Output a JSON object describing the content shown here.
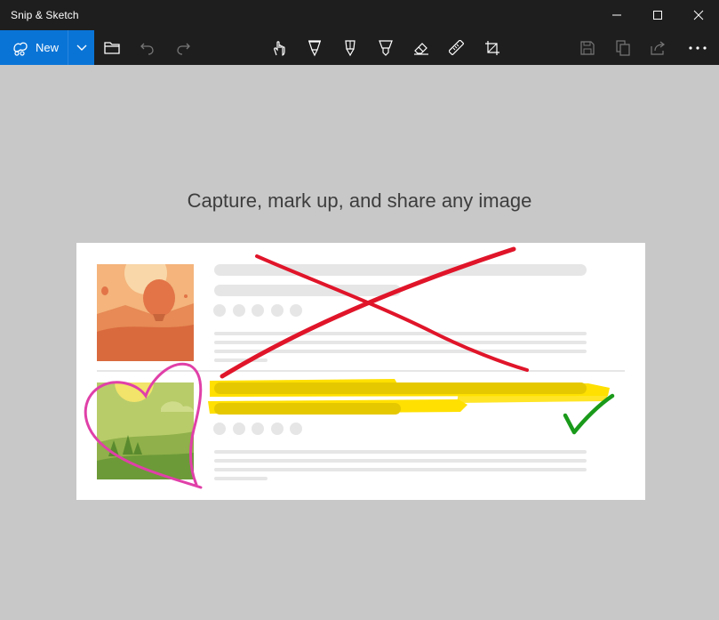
{
  "app": {
    "title": "Snip & Sketch"
  },
  "window_controls": {
    "minimize_icon": "minimize-icon",
    "maximize_icon": "maximize-icon",
    "close_icon": "close-icon"
  },
  "toolbar": {
    "new_label": "New",
    "new_icon": "snip-icon",
    "tools": [
      "open-file-icon",
      "undo-icon",
      "redo-icon",
      "touch-writing-icon",
      "ballpoint-pen-icon",
      "pencil-icon",
      "highlighter-icon",
      "eraser-icon",
      "ruler-icon",
      "crop-icon",
      "save-icon",
      "copy-icon",
      "share-icon",
      "more-icon"
    ]
  },
  "main": {
    "tagline": "Capture, mark up, and share any image"
  },
  "colors": {
    "accent": "#0a74d6",
    "title_bg": "#1e1e1e",
    "canvas_bg": "#c8c8c8",
    "red_ink": "#e0152a",
    "yellow_highlight": "#ffe000",
    "pink_ink": "#e040a8",
    "green_ink": "#1a9a1a"
  }
}
